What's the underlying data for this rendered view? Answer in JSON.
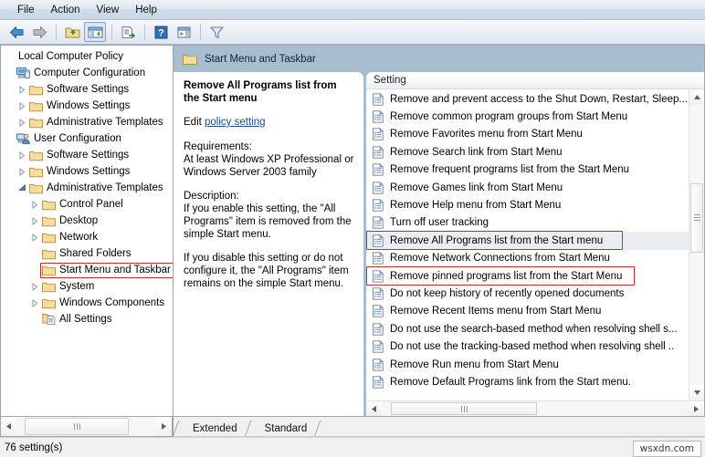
{
  "window": {
    "menu": [
      "File",
      "Action",
      "View",
      "Help"
    ],
    "toolbar_icons": [
      "back-arrow-icon",
      "forward-arrow-icon",
      "separator",
      "up-folder-icon",
      "show-hide-tree-icon",
      "separator",
      "export-list-icon",
      "separator",
      "help-icon",
      "properties-icon",
      "separator",
      "filter-icon"
    ]
  },
  "tree": {
    "root_label": "Local Computer Policy",
    "nodes": [
      {
        "label": "Local Computer Policy",
        "depth": 0,
        "twisty": "none",
        "icon": "none"
      },
      {
        "label": "Computer Configuration",
        "depth": 0,
        "twisty": "none",
        "icon": "computer-icon"
      },
      {
        "label": "Software Settings",
        "depth": 1,
        "twisty": "collapsed",
        "icon": "folder-icon"
      },
      {
        "label": "Windows Settings",
        "depth": 1,
        "twisty": "collapsed",
        "icon": "folder-icon"
      },
      {
        "label": "Administrative Templates",
        "depth": 1,
        "twisty": "collapsed",
        "icon": "folder-icon"
      },
      {
        "label": "User Configuration",
        "depth": 0,
        "twisty": "none",
        "icon": "user-icon"
      },
      {
        "label": "Software Settings",
        "depth": 1,
        "twisty": "collapsed",
        "icon": "folder-icon"
      },
      {
        "label": "Windows Settings",
        "depth": 1,
        "twisty": "collapsed",
        "icon": "folder-icon"
      },
      {
        "label": "Administrative Templates",
        "depth": 1,
        "twisty": "expanded",
        "icon": "folder-icon"
      },
      {
        "label": "Control Panel",
        "depth": 2,
        "twisty": "collapsed",
        "icon": "folder-icon"
      },
      {
        "label": "Desktop",
        "depth": 2,
        "twisty": "collapsed",
        "icon": "folder-icon"
      },
      {
        "label": "Network",
        "depth": 2,
        "twisty": "collapsed",
        "icon": "folder-icon"
      },
      {
        "label": "Shared Folders",
        "depth": 2,
        "twisty": "none",
        "icon": "folder-icon"
      },
      {
        "label": "Start Menu and Taskbar",
        "depth": 2,
        "twisty": "none",
        "icon": "folder-icon",
        "selected": true
      },
      {
        "label": "System",
        "depth": 2,
        "twisty": "collapsed",
        "icon": "folder-icon"
      },
      {
        "label": "Windows Components",
        "depth": 2,
        "twisty": "collapsed",
        "icon": "folder-icon"
      },
      {
        "label": "All Settings",
        "depth": 2,
        "twisty": "none",
        "icon": "all-settings-icon"
      }
    ]
  },
  "pane_header": {
    "title": "Start Menu and Taskbar",
    "icon": "folder-icon"
  },
  "description": {
    "title": "Remove All Programs list from the Start menu",
    "edit_prefix": "Edit ",
    "edit_link": "policy setting",
    "requirements_heading": "Requirements:",
    "requirements_text": "At least Windows XP Professional or Windows Server 2003 family",
    "description_heading": "Description:",
    "description_p1": "If you enable this setting, the \"All Programs\" item is removed from the simple Start menu.",
    "description_p2": "If you disable this setting or do not configure it, the \"All Programs\" item remains on the simple Start menu."
  },
  "list": {
    "column_header": "Setting",
    "rows": [
      {
        "label": "Remove and prevent access to the Shut Down, Restart, Sleep..."
      },
      {
        "label": "Remove common program groups from Start Menu"
      },
      {
        "label": "Remove Favorites menu from Start Menu"
      },
      {
        "label": "Remove Search link from Start Menu"
      },
      {
        "label": "Remove frequent programs list from the Start Menu"
      },
      {
        "label": "Remove Games link from Start Menu"
      },
      {
        "label": "Remove Help menu from Start Menu"
      },
      {
        "label": "Turn off user tracking"
      },
      {
        "label": "Remove All Programs list from the Start menu",
        "selected": true,
        "annotated": true
      },
      {
        "label": "Remove Network Connections from Start Menu"
      },
      {
        "label": "Remove pinned programs list from the Start Menu",
        "annotated": true
      },
      {
        "label": "Do not keep history of recently opened documents"
      },
      {
        "label": "Remove Recent Items menu from Start Menu"
      },
      {
        "label": "Do not use the search-based method when resolving shell s..."
      },
      {
        "label": "Do not use the tracking-based method when resolving shell .."
      },
      {
        "label": "Remove Run menu from Start Menu"
      },
      {
        "label": "Remove Default Programs link from the Start menu."
      }
    ]
  },
  "tabs": [
    {
      "label": "Extended",
      "active": false
    },
    {
      "label": "Standard",
      "active": true
    }
  ],
  "statusbar": {
    "text": "76 setting(s)",
    "watermark": "wsxdn.com"
  },
  "colors": {
    "pane_header_bg": "#a9bdd1",
    "annotation_red": "#c0302b",
    "link_blue": "#1449a8",
    "selection_bg": "#eaeef3"
  }
}
